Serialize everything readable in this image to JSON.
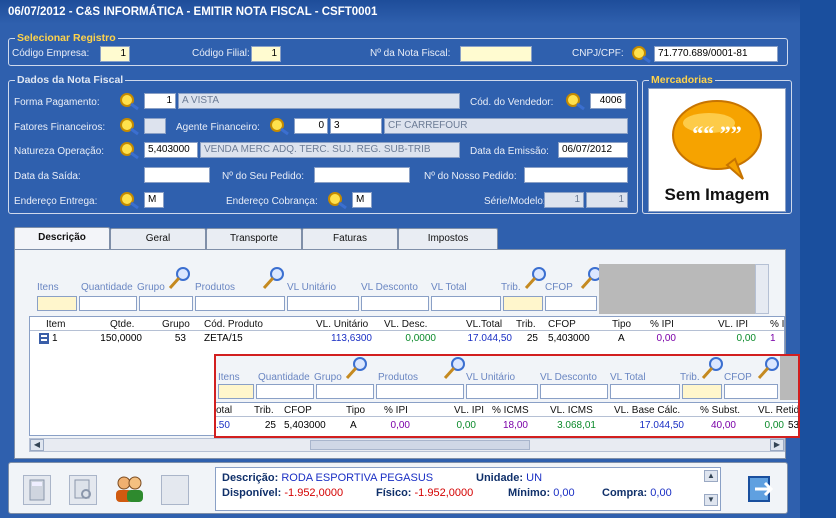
{
  "window": {
    "title": "06/07/2012  -  C&S INFORMÁTICA  -  EMITIR NOTA FISCAL  -  CSFT0001"
  },
  "selecionar": {
    "legend": "Selecionar Registro",
    "codigo_empresa_label": "Código Empresa:",
    "codigo_empresa": "1",
    "codigo_filial_label": "Código Filial:",
    "codigo_filial": "1",
    "nota_label": "Nº da Nota Fiscal:",
    "nota": "",
    "cnpj_label": "CNPJ/CPF:",
    "cnpj": "71.770.689/0001-81"
  },
  "dados": {
    "legend": "Dados da Nota Fiscal",
    "forma_pagamento_label": "Forma Pagamento:",
    "forma_pagamento_cod": "1",
    "forma_pagamento_desc": "A VISTA",
    "vendedor_label": "Cód. do Vendedor:",
    "vendedor": "4006",
    "fatores_label": "Fatores Financeiros:",
    "fatores": "",
    "agente_label": "Agente Financeiro:",
    "agente_cod": "0",
    "agente_num": "3",
    "agente_desc": "CF CARREFOUR",
    "natureza_label": "Natureza Operação:",
    "natureza_cod": "5,403000",
    "natureza_desc": "VENDA MERC ADQ. TERC. SUJ. REG. SUB-TRIB",
    "emissao_label": "Data da  Emissão:",
    "emissao": "06/07/2012",
    "saida_label": "Data da Saída:",
    "saida": "",
    "seu_pedido_label": "Nº do Seu Pedido:",
    "seu_pedido": "",
    "nosso_pedido_label": "Nº do Nosso Pedido:",
    "nosso_pedido": "",
    "entrega_label": "Endereço  Entrega:",
    "entrega": "M",
    "cobranca_label": "Endereço Cobrança:",
    "cobranca": "M",
    "serie_label": "Série/Modelo:",
    "serie": "1",
    "modelo": "1"
  },
  "mercadorias": {
    "legend": "Mercadorias",
    "no_image": "Sem Imagem",
    "bubble": "““  ””"
  },
  "tabs": [
    "Descrição",
    "Geral",
    "Transporte",
    "Faturas",
    "Impostos"
  ],
  "filters": {
    "itens": "Itens",
    "quantidade": "Quantidade",
    "grupo": "Grupo",
    "produtos": "Produtos",
    "vl_unitario": "VL Unitário",
    "vl_desconto": "VL Desconto",
    "vl_total": "VL Total",
    "trib": "Trib.",
    "cfop": "CFOP"
  },
  "grid": {
    "headers": [
      "Item",
      "Qtde.",
      "Grupo",
      "Cód. Produto",
      "VL. Unitário",
      "VL. Desc.",
      "VL.Total",
      "Trib.",
      "CFOP",
      "Tipo",
      "% IPI",
      "VL. IPI",
      "% I"
    ],
    "row": [
      "1",
      "150,0000",
      "53",
      "ZETA/15",
      "113,6300",
      "0,0000",
      "17.044,50",
      "25",
      "5,403000",
      "A",
      "0,00",
      "0,00",
      "1"
    ]
  },
  "popup": {
    "filters": {
      "itens": "Itens",
      "quantidade": "Quantidade",
      "grupo": "Grupo",
      "produtos": "Produtos",
      "vl_unitario": "VL Unitário",
      "vl_desconto": "VL Desconto",
      "vl_total": "VL Total",
      "trib": "Trib.",
      "cfop": "CFOP"
    },
    "headers": [
      "otal",
      "Trib.",
      "CFOP",
      "Tipo",
      "% IPI",
      "VL. IPI",
      "% ICMS",
      "VL. ICMS",
      "VL. Base Cálc.",
      "% Subst.",
      "VL. Retido",
      "Clas"
    ],
    "row": [
      ".50",
      "25",
      "5,403000",
      "A",
      "0,00",
      "0,00",
      "18,00",
      "3.068,01",
      "17.044,50",
      "40,00",
      "0,00",
      "53"
    ]
  },
  "footer": {
    "descricao_label": "Descrição:",
    "descricao": "RODA ESPORTIVA PEGASUS",
    "unidade_label": "Unidade:",
    "unidade": "UN",
    "disponivel_label": "Disponível:",
    "disponivel": "-1.952,0000",
    "fisico_label": "Físico:",
    "fisico": "-1.952,0000",
    "minimo_label": "Mínimo:",
    "minimo": "0,00",
    "compra_label": "Compra:",
    "compra": "0,00"
  },
  "colors": {
    "title_bg": "#2f60ae",
    "legend": "#ffd34a",
    "link": "#0000cc",
    "negative": "#d40000",
    "popup_border": "#d21f1f"
  }
}
